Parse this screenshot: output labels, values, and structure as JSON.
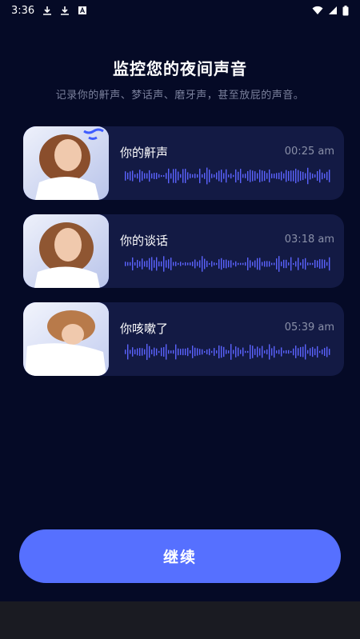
{
  "status_bar": {
    "time": "3:36"
  },
  "header": {
    "title": "监控您的夜间声音",
    "subtitle": "记录你的鼾声、梦话声、磨牙声，甚至放屁的声音。"
  },
  "cards": [
    {
      "label": "你的鼾声",
      "time": "00:25 am"
    },
    {
      "label": "你的谈话",
      "time": "03:18 am"
    },
    {
      "label": "你咳嗽了",
      "time": "05:39 am"
    }
  ],
  "continue_button": {
    "label": "继续"
  },
  "colors": {
    "background": "#050a26",
    "card": "#131a44",
    "accent": "#5670ff",
    "wave": "#5b63ff"
  }
}
